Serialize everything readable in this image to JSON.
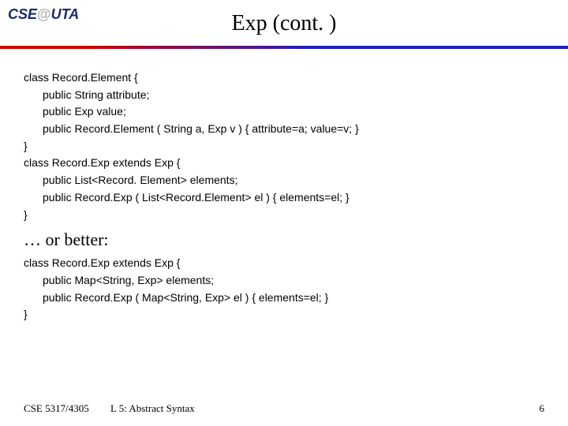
{
  "logo": {
    "left": "CSE",
    "at": "@",
    "right": "UTA"
  },
  "title": "Exp (cont. )",
  "code1": [
    "class Record.Element {",
    "public String attribute;",
    "public Exp value;",
    "public Record.Element ( String a, Exp v ) { attribute=a; value=v; }",
    "}",
    "class Record.Exp extends Exp {",
    "public List<Record. Element> elements;",
    "public Record.Exp ( List<Record.Element> el ) { elements=el; }",
    "}"
  ],
  "better": "… or better:",
  "code2": [
    "class Record.Exp extends Exp {",
    "public Map<String, Exp> elements;",
    "public Record.Exp ( Map<String, Exp> el ) { elements=el; }",
    "}"
  ],
  "footer": {
    "left": "CSE 5317/4305",
    "center": "L 5: Abstract Syntax",
    "page": "6"
  }
}
